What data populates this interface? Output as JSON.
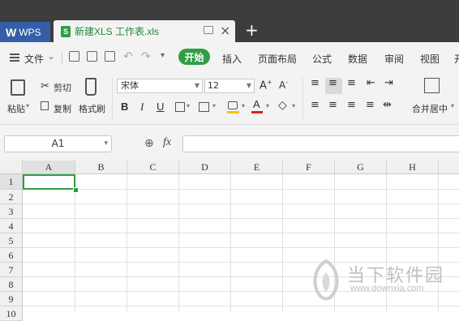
{
  "titlebar": {
    "app_tab": "WPS",
    "doc_tab": "新建XLS 工作表.xls",
    "doc_icon_letter": "S",
    "new_tab": "+"
  },
  "menubar": {
    "file": "文件",
    "start": "开始",
    "items": [
      "插入",
      "页面布局",
      "公式",
      "数据",
      "审阅",
      "视图",
      "开"
    ]
  },
  "ribbon": {
    "paste": "粘贴",
    "cut": "剪切",
    "copy": "复制",
    "format_painter": "格式刷",
    "font_name": "宋体",
    "font_size": "12",
    "bold": "B",
    "italic": "I",
    "underline": "U",
    "merge_center": "合并居中"
  },
  "formula_bar": {
    "name_box": "A1",
    "fx": "fx",
    "content": ""
  },
  "sheet": {
    "columns": [
      "A",
      "B",
      "C",
      "D",
      "E",
      "F",
      "G",
      "H"
    ],
    "rows": [
      "1",
      "2",
      "3",
      "4",
      "5",
      "6",
      "7",
      "8",
      "9",
      "10"
    ],
    "selected_cell": "A1"
  },
  "watermark": {
    "text": "当下软件园",
    "url": "www.downxia.com"
  }
}
